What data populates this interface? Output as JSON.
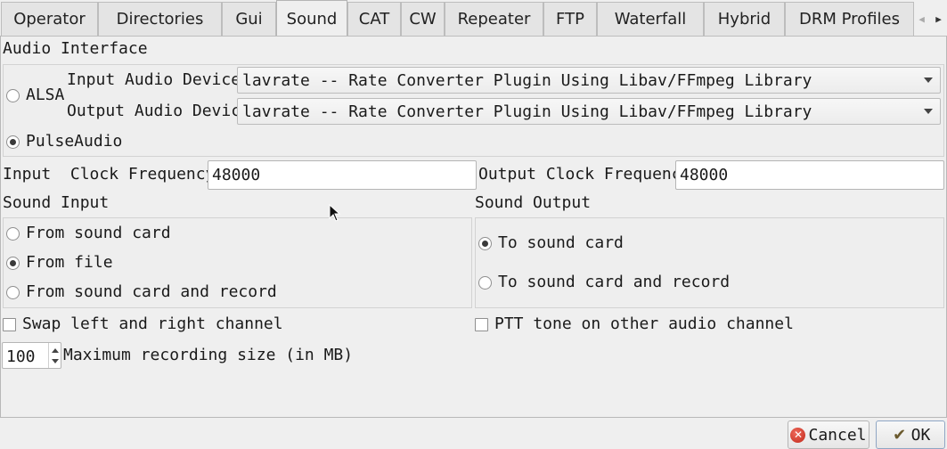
{
  "tabs": [
    {
      "label": "Operator"
    },
    {
      "label": "Directories"
    },
    {
      "label": "Gui"
    },
    {
      "label": "Sound"
    },
    {
      "label": "CAT"
    },
    {
      "label": "CW"
    },
    {
      "label": "Repeater"
    },
    {
      "label": "FTP"
    },
    {
      "label": "Waterfall"
    },
    {
      "label": "Hybrid"
    },
    {
      "label": "DRM Profiles"
    }
  ],
  "active_tab": "Sound",
  "audio_interface": {
    "title": "Audio Interface",
    "alsa_label": "ALSA",
    "pulse_label": "PulseAudio",
    "selected": "PulseAudio",
    "input_device_label": "Input Audio Device",
    "input_device_value": "lavrate -- Rate Converter Plugin Using Libav/FFmpeg Library",
    "output_device_label": "Output Audio Device",
    "output_device_value": "lavrate -- Rate Converter Plugin Using Libav/FFmpeg Library"
  },
  "clock": {
    "input_label": "Input  Clock Frequency",
    "input_value": "48000",
    "output_label": "Output Clock Frequency",
    "output_value": "48000"
  },
  "sound_input": {
    "title": "Sound Input",
    "options": [
      "From sound card",
      "From file",
      "From sound card and record"
    ],
    "selected": "From file"
  },
  "sound_output": {
    "title": "Sound Output",
    "options": [
      "To sound card",
      "To sound card and record"
    ],
    "selected": "To sound card"
  },
  "swap_channels_label": "Swap left and right channel",
  "swap_channels_checked": false,
  "ptt_tone_label": "PTT tone on other audio channel",
  "ptt_tone_checked": false,
  "recording": {
    "value": "100",
    "label": "Maximum recording size (in MB)"
  },
  "buttons": {
    "cancel_label": "Cancel",
    "ok_label": "OK"
  },
  "icons": {
    "scroll_left": "chevron-left-icon",
    "scroll_right": "chevron-right-icon",
    "cancel": "cancel-icon",
    "ok": "ok-icon"
  }
}
